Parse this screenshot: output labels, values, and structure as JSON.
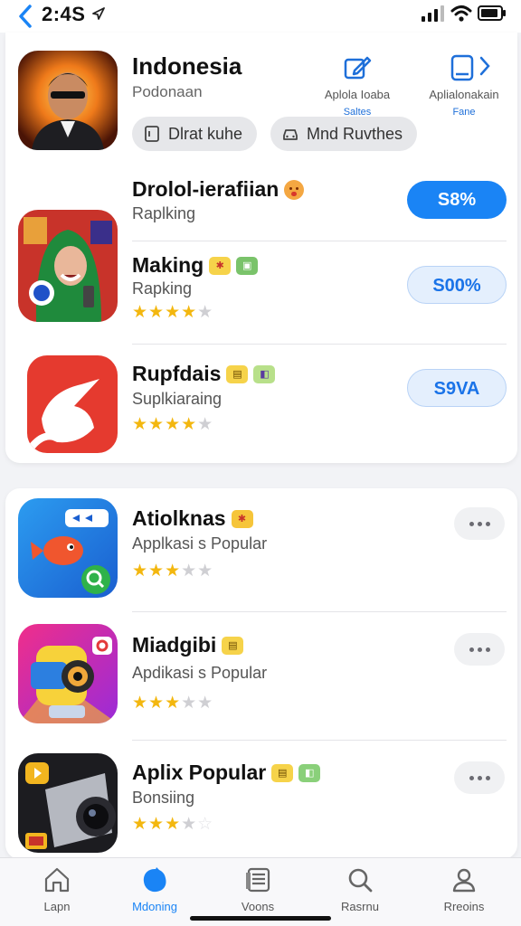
{
  "status": {
    "time": "2:4S"
  },
  "header": {
    "title": "Indonesia",
    "subtitle": "Podonaan",
    "action1": {
      "label": "Aplola Ioaba",
      "sub": "Saltes"
    },
    "action2": {
      "label": "Aplialonakain",
      "sub": "Fane"
    },
    "pill1": "Dlrat kuhe",
    "pill2": "Mnd Ruvthes"
  },
  "top_list": [
    {
      "title": "Drolol-ierafiian",
      "subtitle": "Raplking",
      "price": "S8%"
    },
    {
      "title": "Making",
      "subtitle": "Rapking",
      "price": "S00%",
      "rating": 3.5
    },
    {
      "title": "Rupfdais",
      "subtitle": "Suplkiaraing",
      "price": "S9VA",
      "rating": 3.5
    }
  ],
  "popular": [
    {
      "title": "Atiolknas",
      "subtitle": "Applkasi s Popular",
      "rating": 3
    },
    {
      "title": "Miadgibi",
      "subtitle": "Apdikasi s Popular",
      "rating": 3
    },
    {
      "title": "Aplix Popular",
      "subtitle": "Bonsiing",
      "rating": 3
    }
  ],
  "tabs": [
    {
      "label": "Lapn"
    },
    {
      "label": "Mdoning"
    },
    {
      "label": "Voons"
    },
    {
      "label": "Rasrnu"
    },
    {
      "label": "Rreoins"
    }
  ],
  "colors": {
    "accent": "#1a84f5",
    "star": "#f3b70f"
  }
}
